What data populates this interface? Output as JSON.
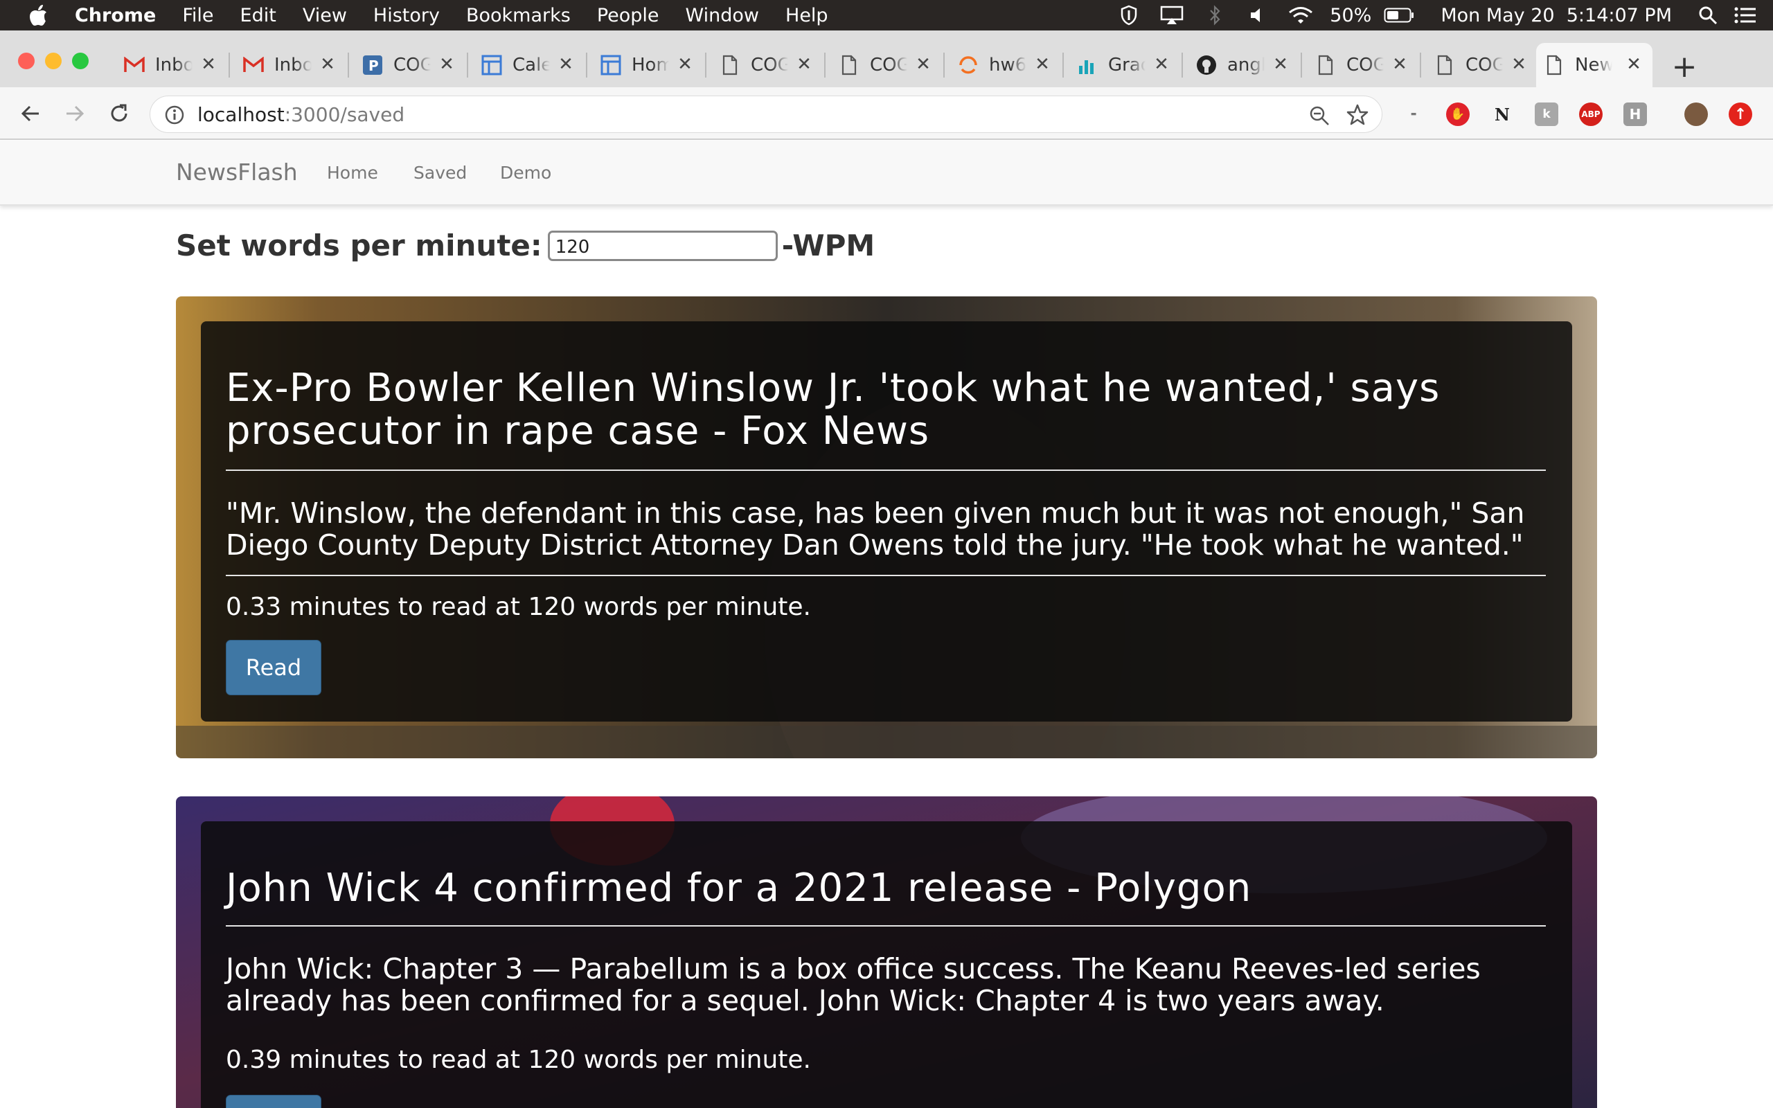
{
  "menubar": {
    "app_name": "Chrome",
    "items": [
      "File",
      "Edit",
      "View",
      "History",
      "Bookmarks",
      "People",
      "Window",
      "Help"
    ],
    "battery": "50%",
    "clock": "Mon May 20  5:14:07 PM"
  },
  "tabs": [
    {
      "title": "Inbox",
      "icon": "gmail-icon"
    },
    {
      "title": "Inbox",
      "icon": "gmail-icon"
    },
    {
      "title": "COG",
      "icon": "p-logo-icon"
    },
    {
      "title": "Calendar",
      "icon": "layout-icon"
    },
    {
      "title": "Home",
      "icon": "layout-icon"
    },
    {
      "title": "COG",
      "icon": "document-icon"
    },
    {
      "title": "COG",
      "icon": "document-icon"
    },
    {
      "title": "hw6",
      "icon": "spinner-icon"
    },
    {
      "title": "Grade",
      "icon": "bar-chart-icon"
    },
    {
      "title": "angl",
      "icon": "github-icon"
    },
    {
      "title": "COG",
      "icon": "document-icon"
    },
    {
      "title": "COG",
      "icon": "document-icon"
    },
    {
      "title": "News",
      "icon": "document-icon",
      "active": true
    }
  ],
  "toolbar": {
    "url_host": "localhost",
    "url_path": ":3000/saved",
    "colors": {
      "abp": "#d4201b",
      "red_ext": "#e0222a",
      "upload_ext": "#e3231c"
    }
  },
  "app": {
    "brand": "NewsFlash",
    "nav": [
      "Home",
      "Saved",
      "Demo"
    ],
    "wpm_label": "Set words per minute:",
    "wpm_value": "120",
    "wpm_suffix": "-WPM",
    "read_label": "Read"
  },
  "articles": [
    {
      "title": "Ex-Pro Bowler Kellen Winslow Jr. 'took what he wanted,' says prosecutor in rape case - Fox News",
      "description": "\"Mr. Winslow, the defendant in this case, has been given much but it was not enough,\" San Diego County Deputy District Attorney Dan Owens told the jury. \"He took what he wanted.\"",
      "read_time": "0.33 minutes to read at 120 words per minute."
    },
    {
      "title": "John Wick 4 confirmed for a 2021 release - Polygon",
      "description": "John Wick: Chapter 3 — Parabellum is a box office success. The Keanu Reeves-led series already has been confirmed for a sequel. John Wick: Chapter 4 is two years away.",
      "read_time": "0.39 minutes to read at 120 words per minute."
    }
  ]
}
